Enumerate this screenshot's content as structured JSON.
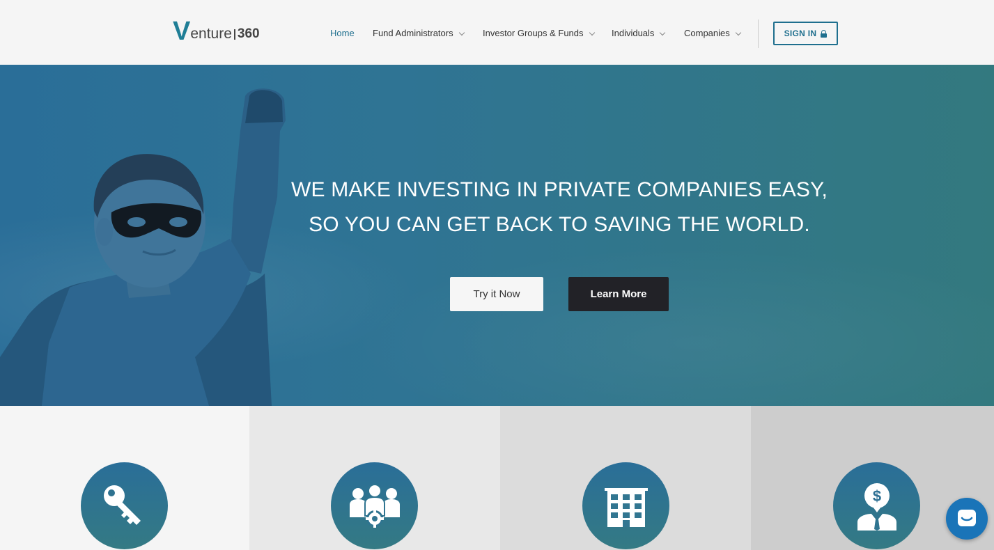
{
  "brand": {
    "logo_v": "V",
    "logo_word": "enture",
    "logo_num": "360"
  },
  "nav": {
    "items": [
      {
        "label": "Home",
        "active": true,
        "dropdown": false
      },
      {
        "label": "Fund Administrators",
        "active": false,
        "dropdown": true
      },
      {
        "label": "Investor Groups & Funds",
        "active": false,
        "dropdown": true
      },
      {
        "label": "Individuals",
        "active": false,
        "dropdown": true
      },
      {
        "label": "Companies",
        "active": false,
        "dropdown": true
      }
    ],
    "signin_label": "SIGN IN",
    "signin_icon": "lock-icon"
  },
  "hero": {
    "line1": "WE MAKE INVESTING IN PRIVATE COMPANIES EASY,",
    "line2": "SO YOU CAN GET BACK TO SAVING THE WORLD.",
    "try_label": "Try it Now",
    "learn_label": "Learn More"
  },
  "features": [
    {
      "icon": "key-icon"
    },
    {
      "icon": "group-settings-icon"
    },
    {
      "icon": "building-icon"
    },
    {
      "icon": "investor-dollar-icon"
    }
  ],
  "chat": {
    "icon": "chat-icon"
  },
  "colors": {
    "accent": "#1f6f8e",
    "hero_start": "#2a6e98",
    "hero_end": "#33797f",
    "dark_button": "#222227",
    "chat": "#1a74b8"
  }
}
